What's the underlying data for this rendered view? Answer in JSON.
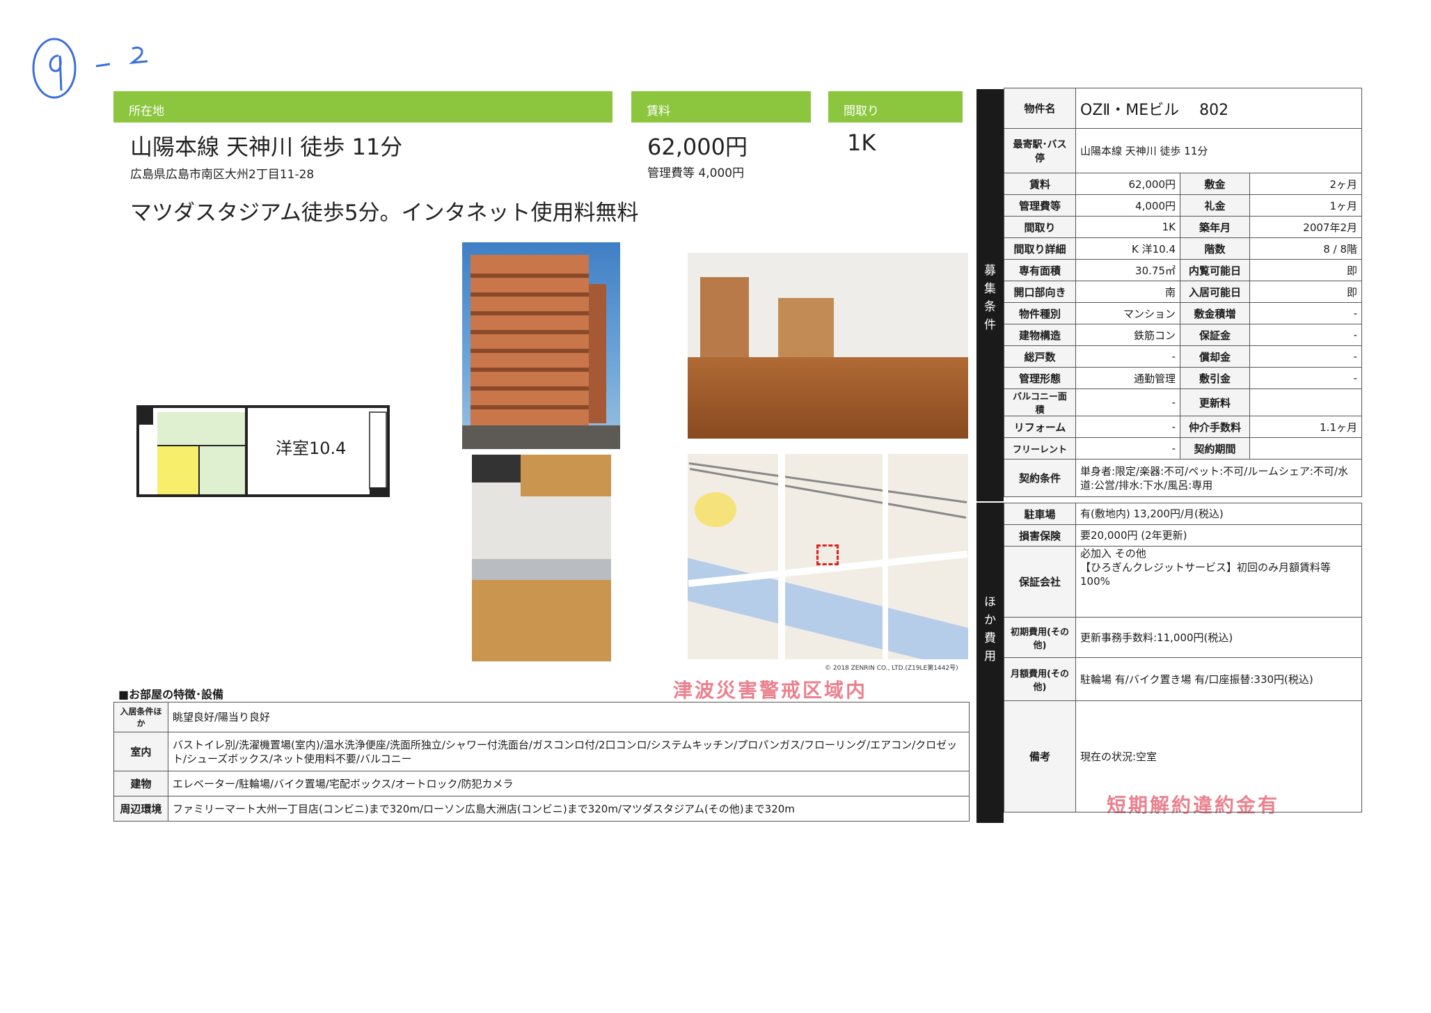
{
  "handwritten_mark": "④-2",
  "header": {
    "location_label": "所在地",
    "rent_label": "賃料",
    "layout_label": "間取り",
    "line_walk": "山陽本線 天神川 徒歩 11分",
    "address": "広島県広島市南区大州2丁目11-28",
    "rent": "62,000円",
    "mgmt_fee": "管理費等 4,000円",
    "layout": "1K",
    "catch_copy": "マツダスタジアム徒歩5分。インタネット使用料無料"
  },
  "floorplan_label": "洋室10.4",
  "map_credit": "© 2018 ZENRIN CO., LTD.(Z19LE第1442号)",
  "stamps": {
    "tsunami": "津波災害警戒区域内",
    "penalty": "短期解約違約金有"
  },
  "side_labels": {
    "recruit": [
      "募",
      "集",
      "条",
      "件"
    ],
    "other": [
      "ほ",
      "か",
      "費",
      "用"
    ]
  },
  "property": {
    "name_label": "物件名",
    "name": "OZⅡ・MEビル　 802",
    "station_label": "最寄駅･バス停",
    "station": "山陽本線 天神川 徒歩 11分",
    "rows": [
      {
        "h1": "賃料",
        "v1": "62,000円",
        "h2": "敷金",
        "v2": "2ヶ月"
      },
      {
        "h1": "管理費等",
        "v1": "4,000円",
        "h2": "礼金",
        "v2": "1ヶ月"
      },
      {
        "h1": "間取り",
        "v1": "1K",
        "h2": "築年月",
        "v2": "2007年2月"
      },
      {
        "h1": "間取り詳細",
        "v1": "K 洋10.4",
        "h2": "階数",
        "v2": "8 / 8階"
      },
      {
        "h1": "専有面積",
        "v1": "30.75㎡",
        "h2": "内覧可能日",
        "v2": "即"
      },
      {
        "h1": "開口部向き",
        "v1": "南",
        "h2": "入居可能日",
        "v2": "即"
      },
      {
        "h1": "物件種別",
        "v1": "マンション",
        "h2": "敷金積増",
        "v2": "-"
      },
      {
        "h1": "建物構造",
        "v1": "鉄筋コン",
        "h2": "保証金",
        "v2": "-"
      },
      {
        "h1": "総戸数",
        "v1": "-",
        "h2": "償却金",
        "v2": "-"
      },
      {
        "h1": "管理形態",
        "v1": "通勤管理",
        "h2": "敷引金",
        "v2": "-"
      },
      {
        "h1": "バルコニー面積",
        "v1": "-",
        "h2": "更新料",
        "v2": ""
      },
      {
        "h1": "リフォーム",
        "v1": "-",
        "h2": "仲介手数料",
        "v2": "1.1ヶ月"
      },
      {
        "h1": "フリーレント",
        "v1": "-",
        "h2": "契約期間",
        "v2": ""
      }
    ],
    "contract_label": "契約条件",
    "contract": "単身者:限定/楽器:不可/ペット:不可/ルームシェア:不可/水道:公営/排水:下水/風呂:専用"
  },
  "costs": [
    {
      "h": "駐車場",
      "v": "有(敷地内) 13,200円/月(税込)"
    },
    {
      "h": "損害保険",
      "v": "要20,000円 (2年更新)"
    },
    {
      "h": "保証会社",
      "v": "必加入 その他\n【ひろぎんクレジットサービス】初回のみ月額賃料等100%"
    },
    {
      "h": "初期費用(その他)",
      "v": "更新事務手数料:11,000円(税込)"
    },
    {
      "h": "月額費用(その他)",
      "v": "駐輪場 有/バイク置き場 有/口座振替:330円(税込)"
    },
    {
      "h": "備考",
      "v": "現在の状況:空室"
    }
  ],
  "features": {
    "title": "■お部屋の特徴･設備",
    "rows": [
      {
        "h": "入居条件ほか",
        "v": "眺望良好/陽当り良好"
      },
      {
        "h": "室内",
        "v": "バストイレ別/洗濯機置場(室内)/温水洗浄便座/洗面所独立/シャワー付洗面台/ガスコンロ付/2口コンロ/システムキッチン/プロパンガス/フローリング/エアコン/クロゼット/シューズボックス/ネット使用料不要/バルコニー"
      },
      {
        "h": "建物",
        "v": "エレベーター/駐輪場/バイク置場/宅配ボックス/オートロック/防犯カメラ"
      },
      {
        "h": "周辺環境",
        "v": "ファミリーマート大州一丁目店(コンビニ)まで320m/ローソン広島大洲店(コンビニ)まで320m/マツダスタジアム(その他)まで320m"
      }
    ]
  },
  "colors": {
    "accent": "#8cc63f",
    "stamp": "#e86a7a"
  }
}
